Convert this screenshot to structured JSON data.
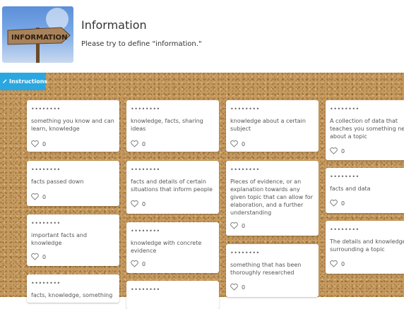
{
  "page": {
    "title": "Information",
    "subtitle": "Please try to define \"information.\"",
    "thumbnail_sign_text": "INFORMATION"
  },
  "instructions_label": "Instructions",
  "columns": [
    [
      {
        "author": "••••••••",
        "text": "something you know and can learn, knowledge",
        "likes": "0"
      },
      {
        "author": "••••••••",
        "text": "facts passed down",
        "likes": "0"
      },
      {
        "author": "••••••••",
        "text": "important facts and knowledge",
        "likes": "0"
      },
      {
        "author": "••••••••",
        "text": "facts, knowledge, something",
        "likes": ""
      }
    ],
    [
      {
        "author": "••••••••",
        "text": "knowledge, facts, sharing ideas",
        "likes": "0"
      },
      {
        "author": "••••••••",
        "text": "facts and details of certain situations that inform people",
        "likes": "0"
      },
      {
        "author": "••••••••",
        "text": "knowledge with concrete evidence",
        "likes": "0"
      },
      {
        "author": "••••••••",
        "text": "",
        "likes": ""
      }
    ],
    [
      {
        "author": "••••••••",
        "text": "knowledge about a certain subject",
        "likes": "0"
      },
      {
        "author": "••••••••",
        "text": "Pieces of evidence, or an explanation towards any given topic that can allow for elaboration, and a further understanding",
        "likes": "0"
      },
      {
        "author": "••••••••",
        "text": "something that has been thoroughly researched",
        "likes": "0"
      }
    ],
    [
      {
        "author": "••••••••",
        "text": "A collection of data that teaches you something new about a topic",
        "likes": "0"
      },
      {
        "author": "••••••••",
        "text": "facts and data",
        "likes": "0"
      },
      {
        "author": "••••••••",
        "text": "The details and knowledge surrounding a topic",
        "likes": "0"
      }
    ]
  ]
}
